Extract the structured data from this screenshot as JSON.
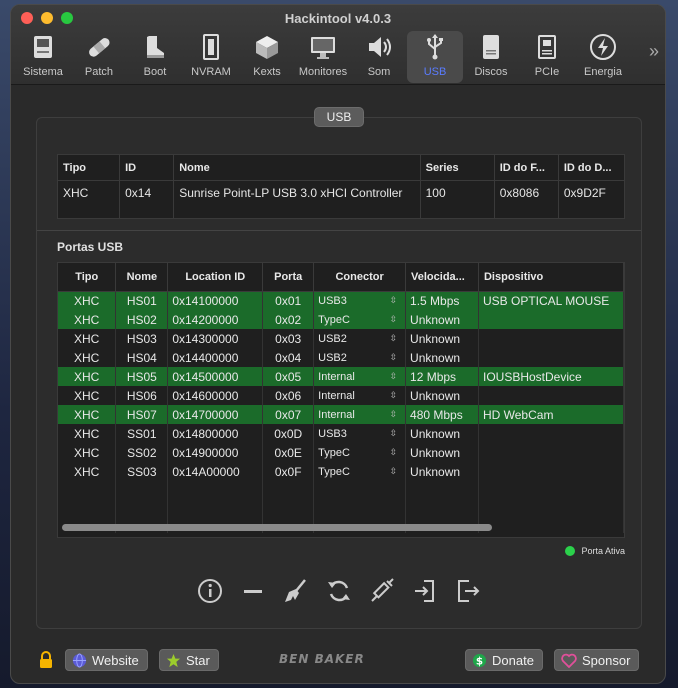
{
  "window": {
    "title": "Hackintool v4.0.3"
  },
  "toolbar": {
    "items": [
      {
        "label": "Sistema",
        "icon": "computer-icon"
      },
      {
        "label": "Patch",
        "icon": "bandage-icon"
      },
      {
        "label": "Boot",
        "icon": "boot-icon"
      },
      {
        "label": "NVRAM",
        "icon": "nvram-chip-icon"
      },
      {
        "label": "Kexts",
        "icon": "kext-blocks-icon"
      },
      {
        "label": "Monitores",
        "icon": "display-icon"
      },
      {
        "label": "Som",
        "icon": "speaker-icon"
      },
      {
        "label": "USB",
        "icon": "usb-icon"
      },
      {
        "label": "Discos",
        "icon": "disk-icon"
      },
      {
        "label": "PCIe",
        "icon": "pcie-card-icon"
      },
      {
        "label": "Energia",
        "icon": "energy-bolt-icon"
      }
    ],
    "active": "USB",
    "more": "»"
  },
  "usb_group": {
    "title": "USB",
    "controller_table": {
      "columns": [
        "Tipo",
        "ID",
        "Nome",
        "Series",
        "ID do F...",
        "ID do D..."
      ],
      "rows": [
        [
          "XHC",
          "0x14",
          "Sunrise Point-LP USB 3.0 xHCI Controller",
          "100",
          "0x8086",
          "0x9D2F"
        ]
      ]
    },
    "ports_label": "Portas USB",
    "ports_table": {
      "columns": [
        "Tipo",
        "Nome",
        "Location ID",
        "Porta",
        "Conector",
        "Velocida...",
        "Dispositivo"
      ],
      "rows": [
        {
          "tipo": "XHC",
          "nome": "HS01",
          "location": "0x14100000",
          "porta": "0x01",
          "conector": "USB3",
          "velocidade": "1.5 Mbps",
          "dispositivo": "USB OPTICAL MOUSE",
          "active": true
        },
        {
          "tipo": "XHC",
          "nome": "HS02",
          "location": "0x14200000",
          "porta": "0x02",
          "conector": "TypeC",
          "velocidade": "Unknown",
          "dispositivo": "",
          "active": true
        },
        {
          "tipo": "XHC",
          "nome": "HS03",
          "location": "0x14300000",
          "porta": "0x03",
          "conector": "USB2",
          "velocidade": "Unknown",
          "dispositivo": "",
          "active": false
        },
        {
          "tipo": "XHC",
          "nome": "HS04",
          "location": "0x14400000",
          "porta": "0x04",
          "conector": "USB2",
          "velocidade": "Unknown",
          "dispositivo": "",
          "active": false
        },
        {
          "tipo": "XHC",
          "nome": "HS05",
          "location": "0x14500000",
          "porta": "0x05",
          "conector": "Internal",
          "velocidade": "12 Mbps",
          "dispositivo": "IOUSBHostDevice",
          "active": true
        },
        {
          "tipo": "XHC",
          "nome": "HS06",
          "location": "0x14600000",
          "porta": "0x06",
          "conector": "Internal",
          "velocidade": "Unknown",
          "dispositivo": "",
          "active": false
        },
        {
          "tipo": "XHC",
          "nome": "HS07",
          "location": "0x14700000",
          "porta": "0x07",
          "conector": "Internal",
          "velocidade": "480 Mbps",
          "dispositivo": "HD WebCam",
          "active": true
        },
        {
          "tipo": "XHC",
          "nome": "SS01",
          "location": "0x14800000",
          "porta": "0x0D",
          "conector": "USB3",
          "velocidade": "Unknown",
          "dispositivo": "",
          "active": false
        },
        {
          "tipo": "XHC",
          "nome": "SS02",
          "location": "0x14900000",
          "porta": "0x0E",
          "conector": "TypeC",
          "velocidade": "Unknown",
          "dispositivo": "",
          "active": false
        },
        {
          "tipo": "XHC",
          "nome": "SS03",
          "location": "0x14A00000",
          "porta": "0x0F",
          "conector": "TypeC",
          "velocidade": "Unknown",
          "dispositivo": "",
          "active": false
        }
      ]
    },
    "legend": "Porta Ativa"
  },
  "actions": [
    "info-icon",
    "remove-icon",
    "broom-icon",
    "refresh-icon",
    "syringe-icon",
    "import-icon",
    "export-icon"
  ],
  "footer": {
    "website": "Website",
    "star": "Star",
    "brand": "BEN BAKER",
    "donate": "Donate",
    "sponsor": "Sponsor"
  },
  "colors": {
    "active_row": "#1b6b2a",
    "accent": "#5a7cff",
    "legend_dot": "#2bd14b"
  }
}
